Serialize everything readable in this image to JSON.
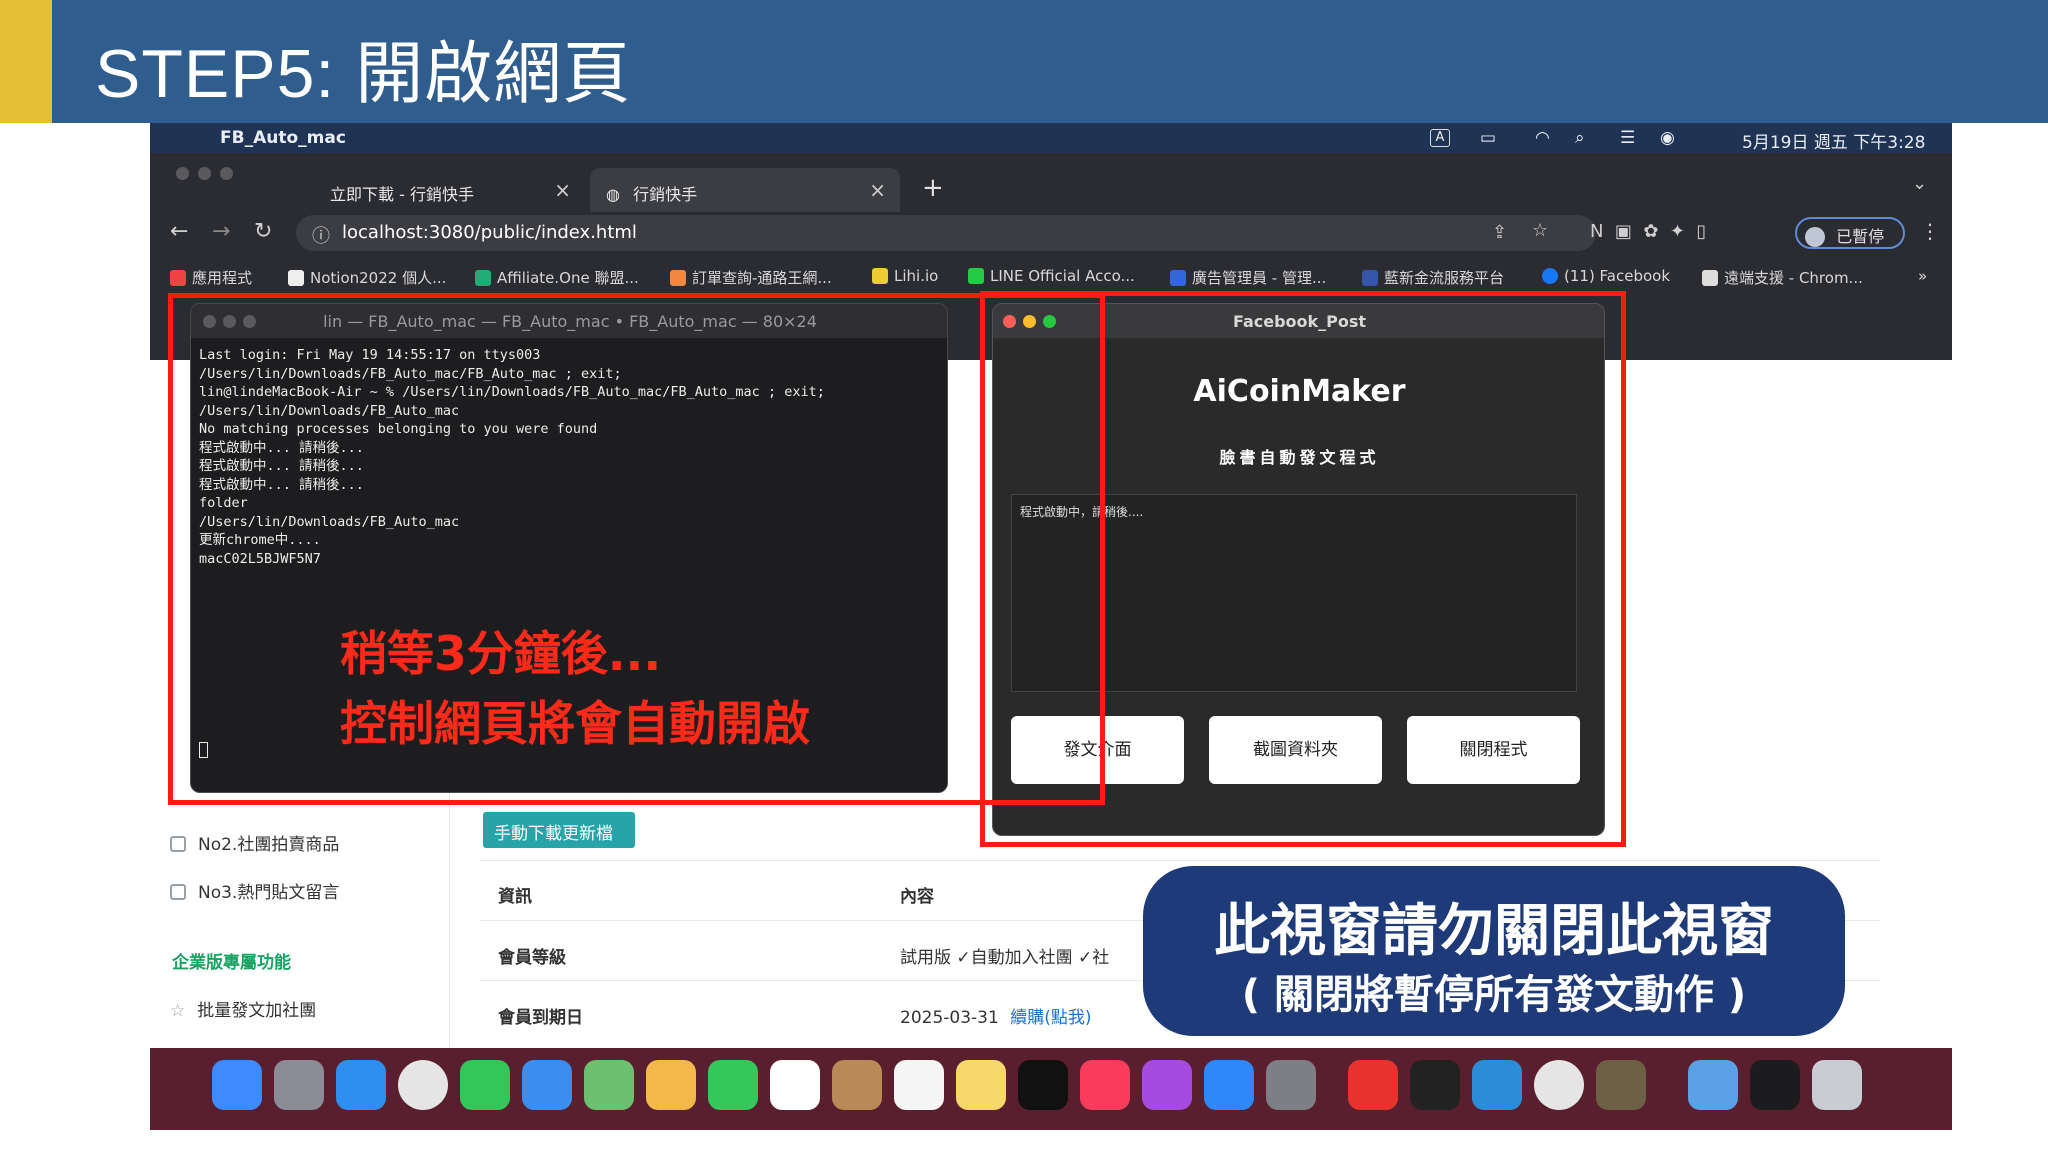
{
  "slide": {
    "title": "STEP5: 開啟網頁"
  },
  "menubar": {
    "app_name": "FB_Auto_mac",
    "datetime": "5月19日 週五 下午3:28"
  },
  "browser": {
    "tabs": [
      {
        "label": "立即下載 - 行銷快手"
      },
      {
        "label": "行銷快手"
      }
    ],
    "new_tab": "+",
    "url": "localhost:3080/public/index.html",
    "profile_label": "已暫停",
    "bookmarks": [
      "應用程式",
      "Notion2022 個人...",
      "Affiliate.One 聯盟...",
      "訂單查詢-通路王網...",
      "Lihi.io",
      "LINE Official Acco...",
      "廣告管理員 - 管理...",
      "藍新金流服務平台",
      "(11) Facebook",
      "遠端支援 - Chrom..."
    ]
  },
  "page": {
    "sidebar": {
      "items": [
        "No2.社團拍賣商品",
        "No3.熱門貼文留言"
      ],
      "section_title": "企業版專屬功能",
      "enterprise_item": "批量發文加社團"
    },
    "download_button": "手動下載更新檔",
    "table": {
      "headers": [
        "資訊",
        "內容"
      ],
      "rows": [
        {
          "label": "會員等級",
          "value": "試用版 ✓自動加入社團 ✓社"
        },
        {
          "label": "會員到期日",
          "value": "2025-03-31",
          "link": "續購(點我)"
        }
      ]
    }
  },
  "terminal": {
    "title": "lin — FB_Auto_mac — FB_Auto_mac • FB_Auto_mac — 80×24",
    "text": "Last login: Fri May 19 14:55:17 on ttys003\n/Users/lin/Downloads/FB_Auto_mac/FB_Auto_mac ; exit;\nlin@lindeMacBook-Air ~ % /Users/lin/Downloads/FB_Auto_mac/FB_Auto_mac ; exit;\n/Users/lin/Downloads/FB_Auto_mac\nNo matching processes belonging to you were found\n程式啟動中... 請稍後...\n程式啟動中... 請稍後...\n程式啟動中... 請稍後...\nfolder\n/Users/lin/Downloads/FB_Auto_mac\n更新chrome中....\nmacC02L5BJWF5N7"
  },
  "overlay": {
    "line1": "稍等3分鐘後...",
    "line2": "控制網頁將會自動開啟"
  },
  "fb_window": {
    "title": "Facebook_Post",
    "brand": "AiCoinMaker",
    "subtitle": "臉書自動發文程式",
    "log": "程式啟動中，請稍後....",
    "buttons": [
      "發文介面",
      "截圖資料夾",
      "關閉程式"
    ]
  },
  "callout": {
    "main": "此視窗請勿關閉此視窗",
    "sub": "( 關閉將暫停所有發文動作 )"
  },
  "colors": {
    "header_bg": "#2f5d8e",
    "accent": "#e5bf33",
    "highlight_red": "#ff1a12",
    "callout_bg": "#1e3a78",
    "teal_button": "#26a4a8"
  }
}
